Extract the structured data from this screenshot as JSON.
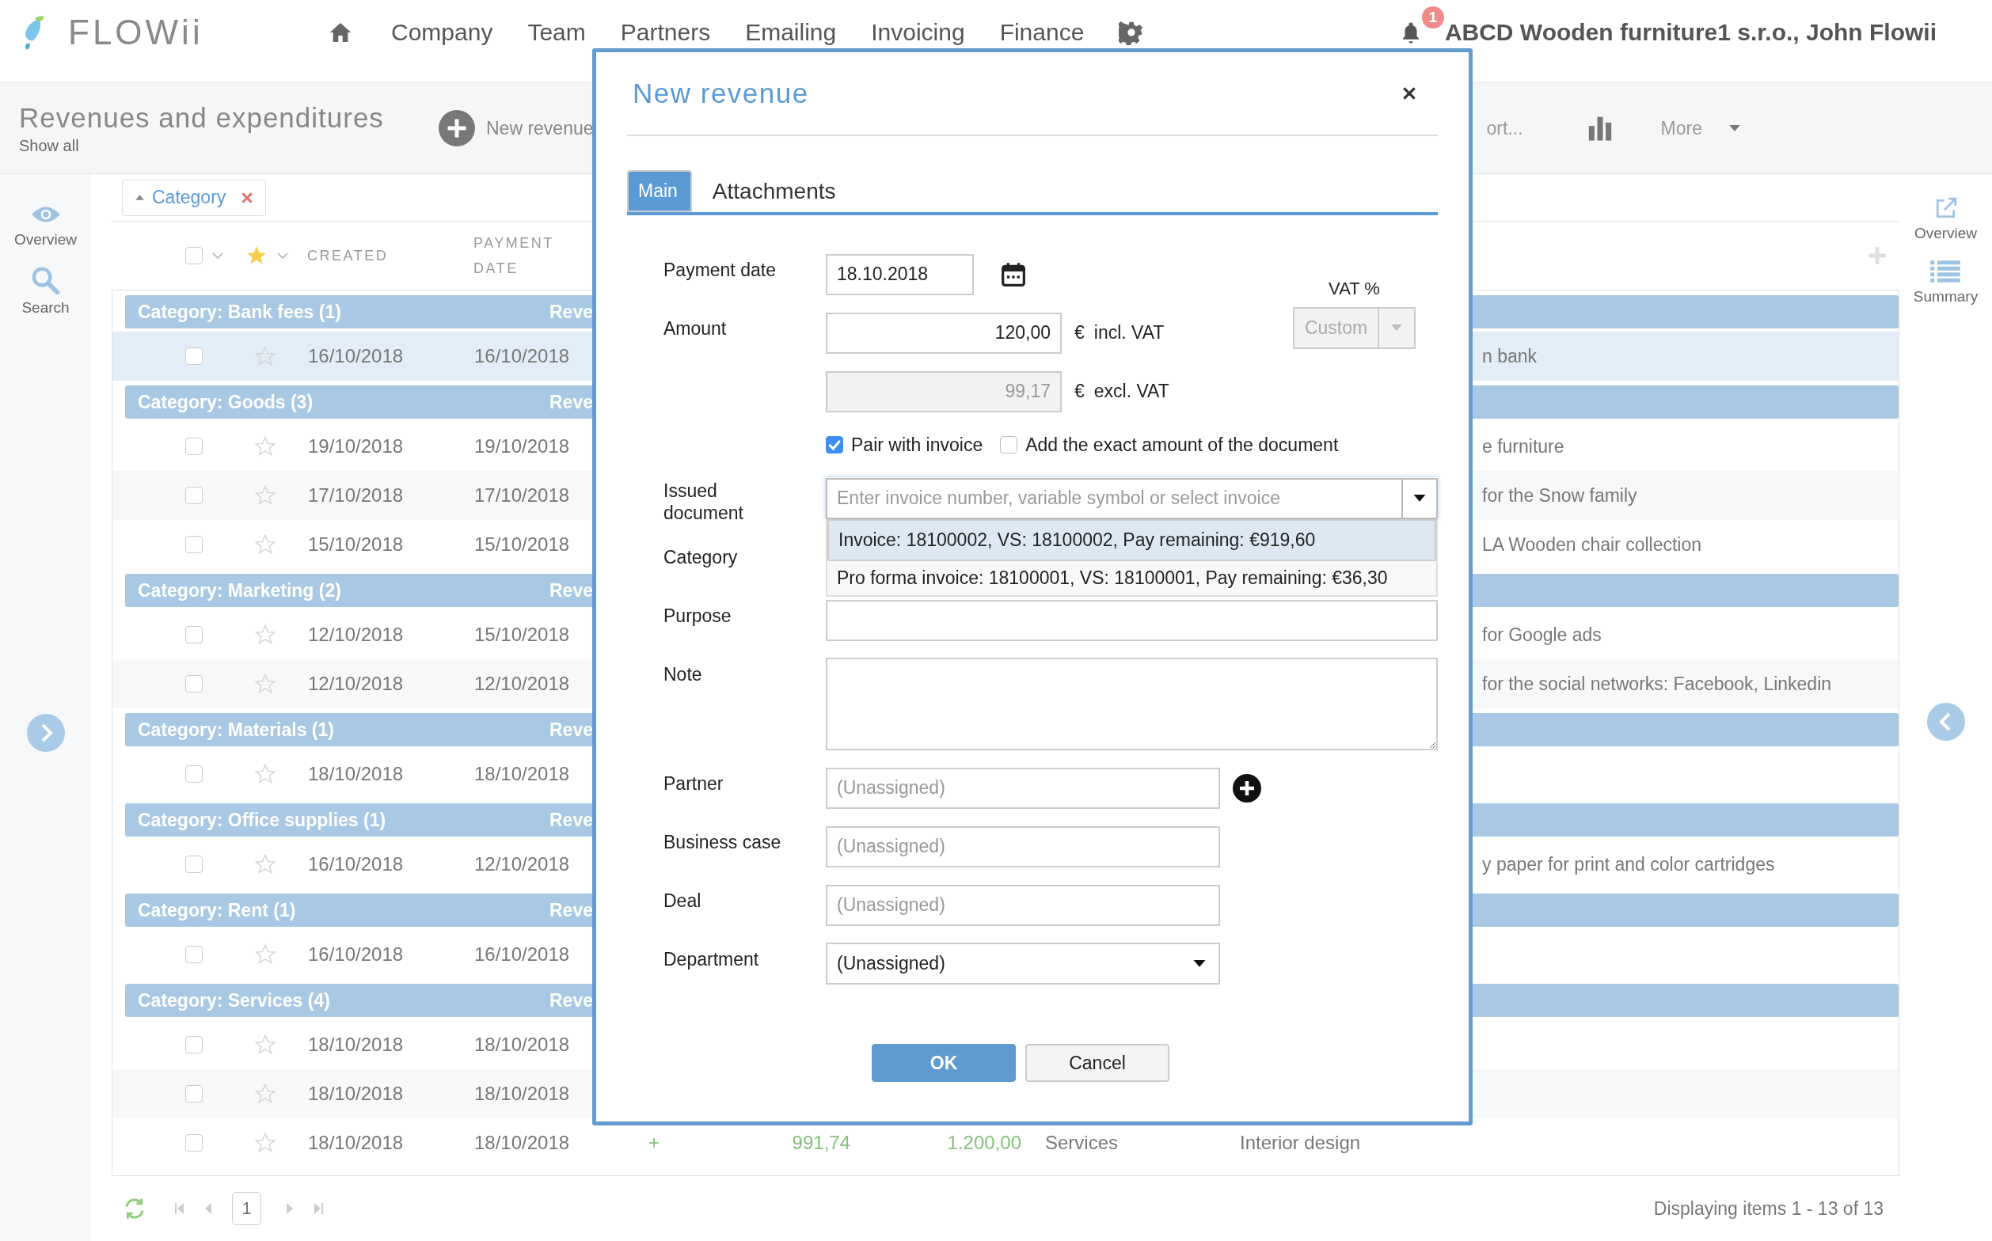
{
  "header": {
    "logo": "FLOWii",
    "nav": [
      "Company",
      "Team",
      "Partners",
      "Emailing",
      "Invoicing",
      "Finance"
    ],
    "notifications": "1",
    "account": "ABCD Wooden furniture1 s.r.o., John Flowii"
  },
  "toolbar": {
    "title": "Revenues and expenditures",
    "subtitle": "Show all",
    "new_button": "New revenue",
    "export_fragment": "ort...",
    "more": "More"
  },
  "left_sidebar": {
    "overview": "Overview",
    "search": "Search"
  },
  "right_sidebar": {
    "overview": "Overview",
    "summary": "Summary"
  },
  "grouping": {
    "chip": "Category"
  },
  "table": {
    "header_checked": false,
    "columns": [
      {
        "label": "CREATED"
      },
      {
        "label": "PAYMENT DATE"
      }
    ],
    "rows": [
      {
        "kind": "group",
        "label": "Category: Bank fees (1)",
        "column_2": "Reve"
      },
      {
        "kind": "covered",
        "checked": false,
        "starred": false,
        "highlighted": true,
        "created": "16/10/2018",
        "payment_date": "16/10/2018",
        "column_9": "n bank"
      },
      {
        "kind": "group",
        "label": "Category: Goods (3)",
        "column_2": "Reve"
      },
      {
        "kind": "covered",
        "checked": false,
        "starred": false,
        "highlighted": false,
        "created": "19/10/2018",
        "payment_date": "19/10/2018",
        "column_9": "e furniture"
      },
      {
        "kind": "covered",
        "checked": false,
        "starred": false,
        "highlighted": false,
        "created": "17/10/2018",
        "payment_date": "17/10/2018",
        "column_9": "for the Snow family"
      },
      {
        "kind": "covered",
        "checked": false,
        "starred": false,
        "highlighted": false,
        "created": "15/10/2018",
        "payment_date": "15/10/2018",
        "column_9": "LA Wooden chair collection"
      },
      {
        "kind": "group",
        "label": "Category: Marketing (2)",
        "column_2": "Reve"
      },
      {
        "kind": "covered",
        "checked": false,
        "starred": false,
        "highlighted": false,
        "created": "12/10/2018",
        "payment_date": "15/10/2018",
        "column_9": "for Google ads"
      },
      {
        "kind": "covered",
        "checked": false,
        "starred": false,
        "highlighted": false,
        "created": "12/10/2018",
        "payment_date": "12/10/2018",
        "column_9": "for the social networks: Facebook, Linkedin"
      },
      {
        "kind": "group",
        "label": "Category: Materials (1)",
        "column_2": "Reve"
      },
      {
        "kind": "covered",
        "checked": false,
        "starred": false,
        "highlighted": false,
        "created": "18/10/2018",
        "payment_date": "18/10/2018"
      },
      {
        "kind": "group",
        "label": "Category: Office supplies (1)",
        "column_2": "Reve"
      },
      {
        "kind": "covered",
        "checked": false,
        "starred": false,
        "highlighted": false,
        "created": "16/10/2018",
        "payment_date": "12/10/2018",
        "column_9": "y paper for print and color cartridges"
      },
      {
        "kind": "group",
        "label": "Category: Rent (1)",
        "column_2": "Reve"
      },
      {
        "kind": "covered",
        "checked": false,
        "starred": false,
        "highlighted": false,
        "created": "16/10/2018",
        "payment_date": "16/10/2018"
      },
      {
        "kind": "group",
        "label": "Category: Services (4)",
        "column_2": "Reve"
      },
      {
        "kind": "covered",
        "checked": false,
        "starred": false,
        "highlighted": false,
        "created": "18/10/2018",
        "payment_date": "18/10/2018"
      },
      {
        "kind": "covered",
        "checked": false,
        "starred": false,
        "highlighted": false,
        "created": "18/10/2018",
        "payment_date": "18/10/2018"
      },
      {
        "kind": "full",
        "checked": false,
        "starred": false,
        "highlighted": false,
        "created": "18/10/2018",
        "payment_date": "18/10/2018",
        "sign": "+",
        "column_6": "991,74",
        "column_7": "1.200,00",
        "column_8": "Services",
        "column_9": "Interior design"
      }
    ]
  },
  "pager": {
    "page": "1",
    "summary": "Displaying items 1 - 13 of 13"
  },
  "dialog": {
    "title": "New revenue",
    "tabs": [
      {
        "label": "Main",
        "selected": true
      },
      {
        "label": "Attachments",
        "selected": false
      }
    ],
    "payment_date": {
      "label": "Payment date",
      "value": "18.10.2018"
    },
    "amount": {
      "label": "Amount",
      "incl": {
        "value": "120,00",
        "currency": "€",
        "note": "incl. VAT"
      },
      "excl": {
        "value": "99,17",
        "currency": "€",
        "note": "excl. VAT",
        "disabled": true
      }
    },
    "vat": {
      "label": "VAT %",
      "value": "Custom",
      "disabled": true
    },
    "options": [
      {
        "label": "Pair with invoice",
        "checked": true
      },
      {
        "label": "Add the exact amount of the document",
        "checked": false
      }
    ],
    "issued_document": {
      "label": "Issued\ndocument",
      "placeholder": "Enter invoice number, variable symbol or select invoice",
      "expanded": true,
      "suggestions": [
        {
          "text": "Invoice: 18100002, VS: 18100002, Pay remaining: €919,60",
          "selected": true
        },
        {
          "text": "Pro forma invoice: 18100001, VS: 18100001, Pay remaining: €36,30",
          "selected": false
        }
      ]
    },
    "category": {
      "label": "Category"
    },
    "purpose": {
      "label": "Purpose"
    },
    "note": {
      "label": "Note"
    },
    "links": [
      {
        "label": "Partner",
        "placeholder": "(Unassigned)",
        "addable": true
      },
      {
        "label": "Business case",
        "placeholder": "(Unassigned)",
        "addable": false
      },
      {
        "label": "Deal",
        "placeholder": "(Unassigned)",
        "addable": false
      }
    ],
    "department": {
      "label": "Department",
      "value": "(Unassigned)"
    },
    "buttons": [
      {
        "label": "OK",
        "kind": "primary"
      },
      {
        "label": "Cancel",
        "kind": "secondary"
      }
    ]
  }
}
